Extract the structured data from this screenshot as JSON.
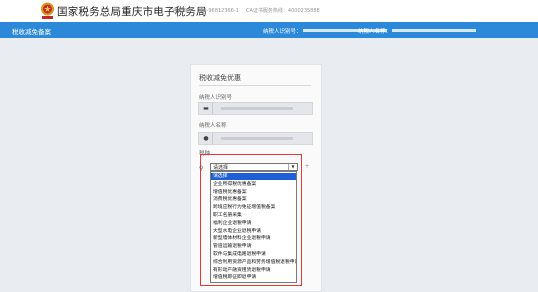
{
  "header": {
    "title": "国家税务总局重庆市电子税务局",
    "hotline": "咨询热线：023-96812366-1",
    "ca_hotline": "CA证书服务热线：4000235888",
    "logo_icon": "tax-emblem-icon"
  },
  "nav": {
    "page_name": "税收减免备案",
    "taxpayer_id_label": "纳税人识别号：",
    "taxpayer_name_label": "纳税人名称："
  },
  "form": {
    "title": "税收减免优惠",
    "taxpayer_id_label": "纳税人识别号",
    "taxpayer_name_label": "纳税人名称",
    "tax_type_label": "税种",
    "select_value": "请选择",
    "plus": "+"
  },
  "dropdown": {
    "options": [
      "请选择",
      "企业所得税优惠备案",
      "增值税优惠备案",
      "消费税优惠备案",
      "跨境应税行为免征增值税备案",
      "职工名册采集",
      "福利企业退税申请",
      "大型水电企业退税申请",
      "新型墙体材料企业退税申请",
      "管道运输退税申请",
      "软件与集成电路退税申请",
      "综合利用资源产品和劳务增值税退税申请",
      "有形动产融资租赁退税申请",
      "增值税即征即退申请"
    ],
    "selected_index": 0
  },
  "colors": {
    "nav_bar": "#2c89d9",
    "highlight": "#e53935",
    "selected_option": "#1e5fd8"
  }
}
